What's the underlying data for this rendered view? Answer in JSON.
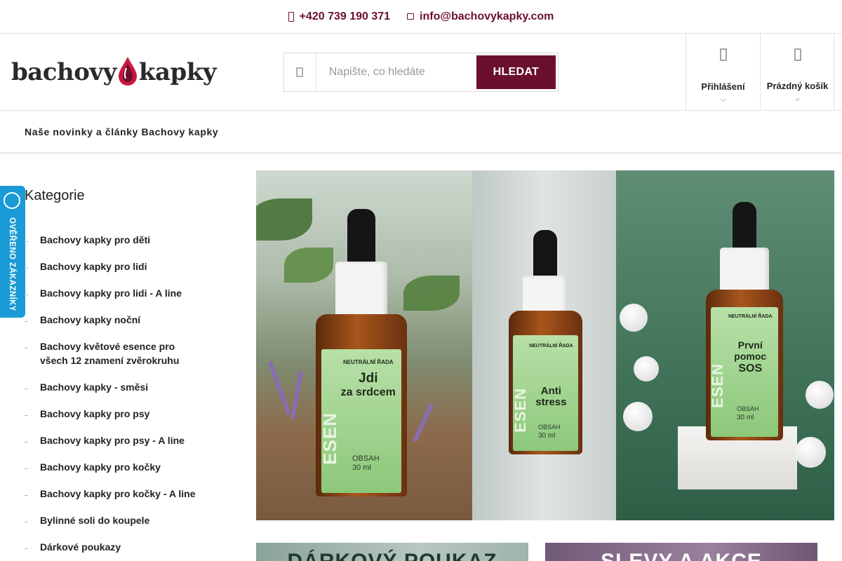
{
  "topbar": {
    "phone": "+420 739 190 371",
    "email": "info@bachovykapky.com"
  },
  "header": {
    "logo_left": "bachovy",
    "logo_right": "kapky",
    "search_placeholder": "Napište, co hledáte",
    "search_button": "HLEDAT",
    "login_label": "Přihlášení",
    "cart_label": "Prázdný košík"
  },
  "nav": {
    "articles_link": "Naše novinky a články Bachovy kapky"
  },
  "badge": {
    "text": "OVĚŘENO ZÁKAZNÍKY"
  },
  "sidebar": {
    "title": "Kategorie",
    "categories": [
      "Bachovy kapky pro děti",
      "Bachovy kapky pro lidi",
      "Bachovy kapky pro lidi - A line",
      "Bachovy kapky noční",
      "Bachovy květové esence pro všech 12 znamení zvěrokruhu",
      "Bachovy kapky - směsi",
      "Bachovy kapky pro psy",
      "Bachovy kapky pro psy - A line",
      "Bachovy kapky pro kočky",
      "Bachovy kapky pro kočky - A line",
      "Bylinné soli do koupele",
      "Dárkové poukazy"
    ]
  },
  "banner": {
    "bottles": [
      {
        "name_line1": "Jdi",
        "name_line2": "za srdcem",
        "series": "NEUTRÁLNÍ ŘADA",
        "brand": "ESEN",
        "volume_label": "OBSAH",
        "volume": "30 ml"
      },
      {
        "name_line1": "Anti",
        "name_line2": "stress",
        "series": "NEUTRÁLNÍ ŘADA",
        "brand": "ESEN",
        "volume_label": "OBSAH",
        "volume": "30 ml"
      },
      {
        "name_line1": "První",
        "name_line2": "pomoc",
        "name_line3": "SOS",
        "series": "NEUTRÁLNÍ ŘADA",
        "brand": "ESEN",
        "volume_label": "OBSAH",
        "volume": "30 ml"
      }
    ]
  },
  "promos": {
    "voucher": "DÁRKOVÝ POUKAZ",
    "sales": "SLEVY A AKCE"
  },
  "colors": {
    "brand": "#6b0f2e",
    "badge": "#1a9ad6"
  }
}
